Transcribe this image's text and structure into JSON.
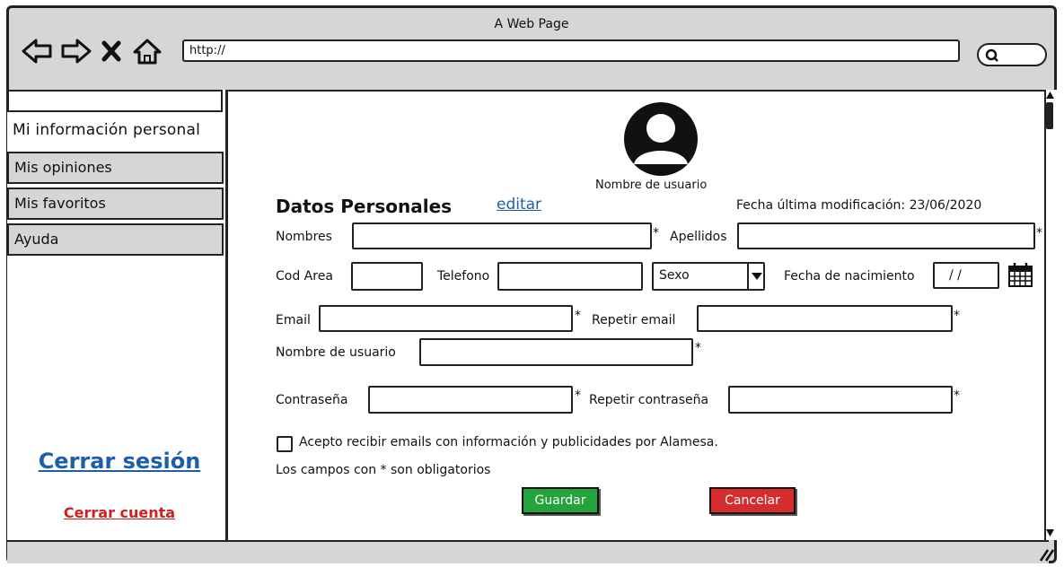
{
  "window": {
    "title": "A Web Page",
    "url": "http://"
  },
  "sidebar": {
    "items": [
      {
        "label": "Mi información personal"
      },
      {
        "label": "Mis opiniones"
      },
      {
        "label": "Mis favoritos"
      },
      {
        "label": "Ayuda"
      }
    ],
    "logout": "Cerrar sesión",
    "close_account": "Cerrar cuenta"
  },
  "profile": {
    "username_caption": "Nombre de usuario"
  },
  "form": {
    "section_title": "Datos Personales",
    "edit_link": "editar",
    "last_modified": "Fecha última modificación: 23/06/2020",
    "labels": {
      "first_names": "Nombres",
      "last_names": "Apellidos",
      "area_code": "Cod Area",
      "phone": "Telefono",
      "sex": "Sexo",
      "birth_date": "Fecha de nacimiento",
      "email": "Email",
      "repeat_email": "Repetir email",
      "username": "Nombre de usuario",
      "password": "Contraseña",
      "repeat_password": "Repetir contraseña"
    },
    "birth_date_value": "/ /",
    "required_mark": "*",
    "checkbox_label": "Acepto recibir emails con información y publicidades por Alamesa.",
    "required_note": "Los campos con * son obligatorios",
    "save_label": "Guardar",
    "cancel_label": "Cancelar"
  },
  "colors": {
    "save": "#24a33c",
    "cancel": "#d52d2d",
    "link": "#1c5fa8",
    "danger": "#d02020"
  }
}
